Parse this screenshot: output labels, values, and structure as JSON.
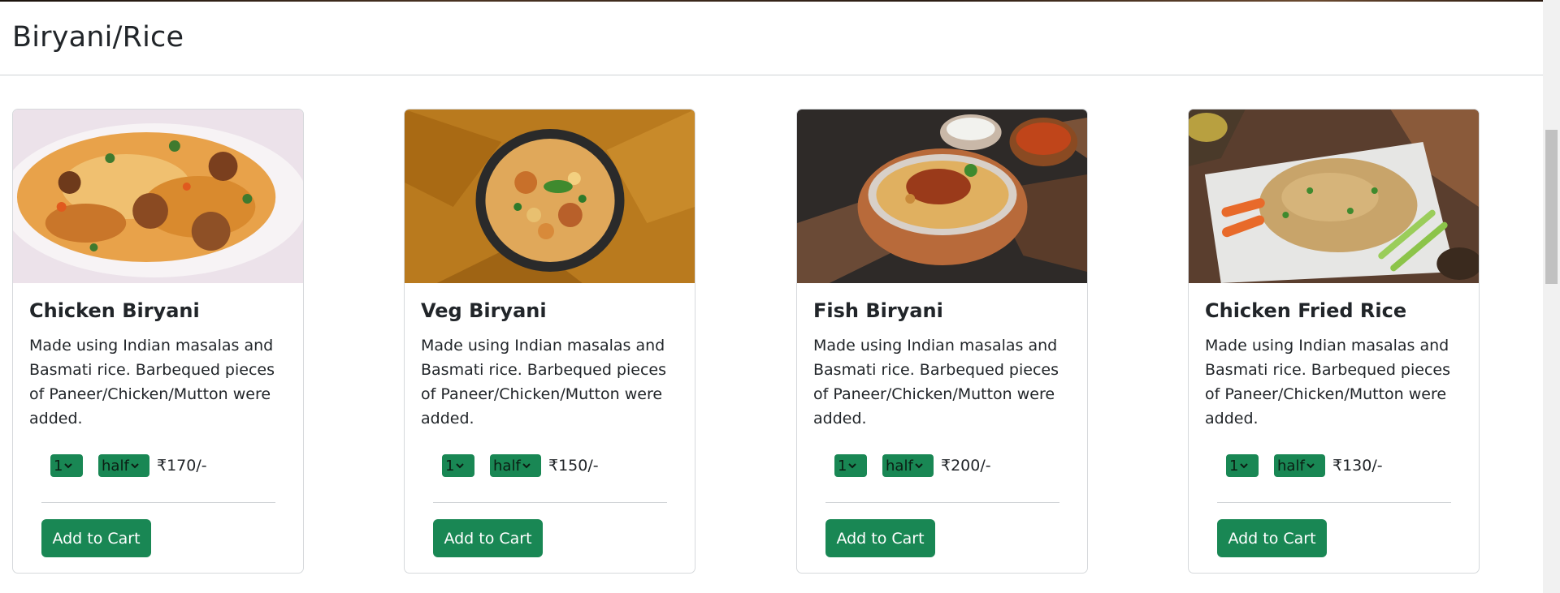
{
  "section": {
    "title": "Biryani/Rice"
  },
  "colors": {
    "accent": "#198754",
    "text": "#212529",
    "border": "#d6d9dc"
  },
  "cards": [
    {
      "title": "Chicken Biryani",
      "description": "Made using Indian masalas and Basmati rice. Barbequed pieces of Paneer/Chicken/Mutton were added.",
      "quantity": "1",
      "size": "half",
      "price": "₹170/-",
      "button_label": "Add to Cart",
      "image_icon": "chicken-biryani-photo"
    },
    {
      "title": "Veg Biryani",
      "description": "Made using Indian masalas and Basmati rice. Barbequed pieces of Paneer/Chicken/Mutton were added.",
      "quantity": "1",
      "size": "half",
      "price": "₹150/-",
      "button_label": "Add to Cart",
      "image_icon": "veg-biryani-photo"
    },
    {
      "title": "Fish Biryani",
      "description": "Made using Indian masalas and Basmati rice. Barbequed pieces of Paneer/Chicken/Mutton were added.",
      "quantity": "1",
      "size": "half",
      "price": "₹200/-",
      "button_label": "Add to Cart",
      "image_icon": "fish-biryani-photo"
    },
    {
      "title": "Chicken Fried Rice",
      "description": "Made using Indian masalas and Basmati rice. Barbequed pieces of Paneer/Chicken/Mutton were added.",
      "quantity": "1",
      "size": "half",
      "price": "₹130/-",
      "button_label": "Add to Cart",
      "image_icon": "chicken-fried-rice-photo"
    }
  ]
}
